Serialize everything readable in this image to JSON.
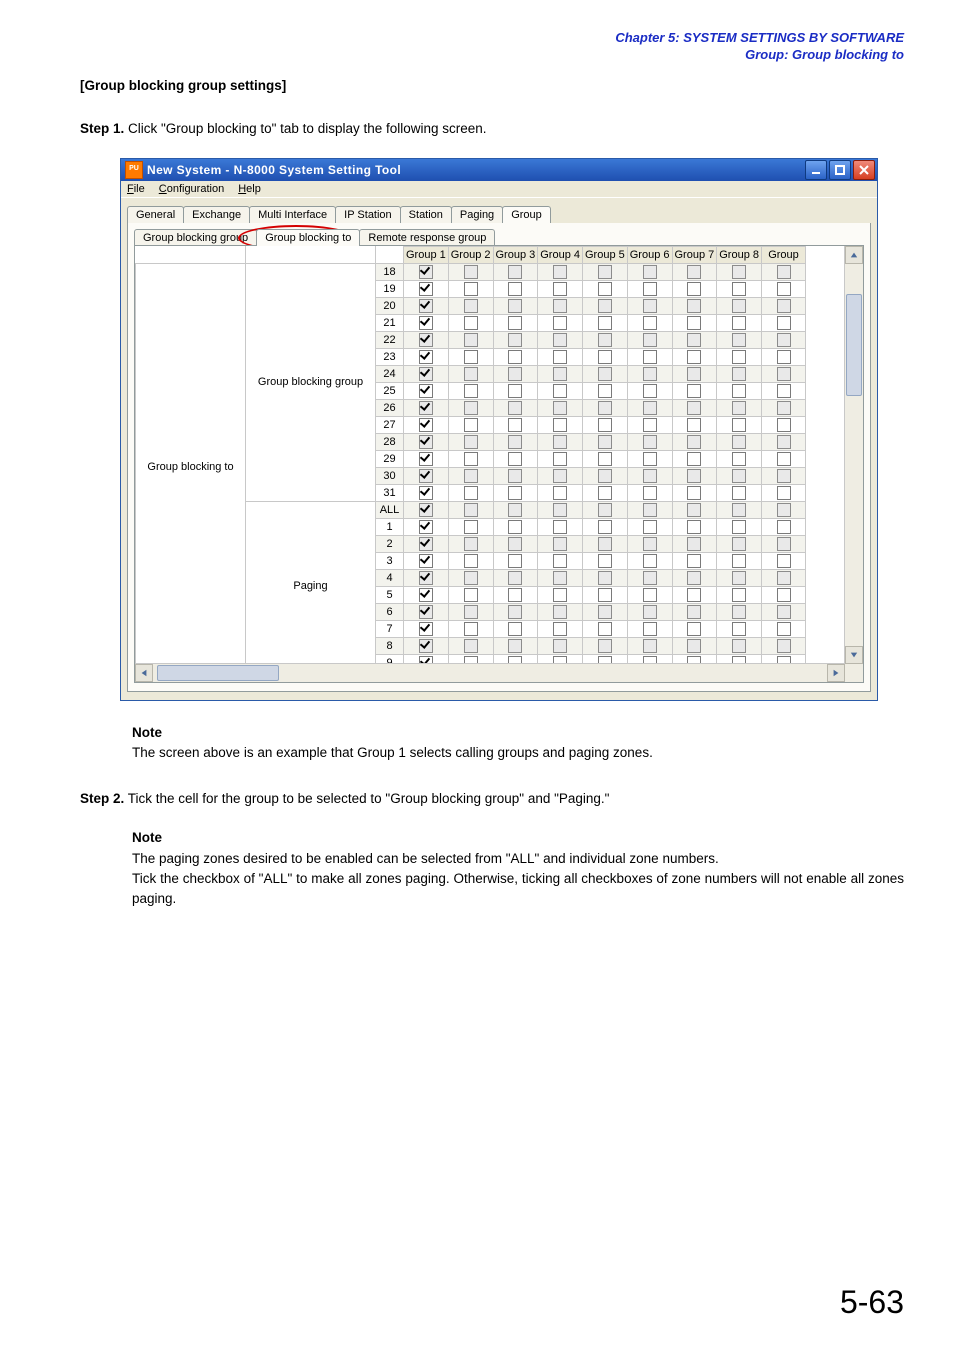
{
  "header": {
    "chapter": "Chapter 5:  SYSTEM SETTINGS BY SOFTWARE",
    "group": "Group: Group blocking to"
  },
  "section_title": "[Group blocking group settings]",
  "step1": {
    "label": "Step 1.",
    "text": " Click \"Group blocking to\" tab to display the following screen."
  },
  "window": {
    "title": "New System - N-8000 System Setting Tool",
    "appicon": "PU"
  },
  "menu": {
    "file": "File",
    "configuration": "Configuration",
    "help": "Help"
  },
  "tabs_top": [
    "General",
    "Exchange",
    "Multi Interface",
    "IP Station",
    "Station",
    "Paging",
    "Group"
  ],
  "tabs_top_active": 6,
  "subtabs": [
    "Group blocking group",
    "Group blocking to",
    "Remote response group"
  ],
  "subtabs_active": 1,
  "grid": {
    "rowhdr1": "Group blocking to",
    "rowhdr2a": "Group blocking group",
    "rowhdr2b": "Paging",
    "cols": [
      "Group 1",
      "Group 2",
      "Group 3",
      "Group 4",
      "Group 5",
      "Group 6",
      "Group 7",
      "Group 8",
      "Group"
    ],
    "rowsA": [
      "18",
      "19",
      "20",
      "21",
      "22",
      "23",
      "24",
      "25",
      "26",
      "27",
      "28",
      "29",
      "30",
      "31"
    ],
    "rowsB": [
      "ALL",
      "1",
      "2",
      "3",
      "4",
      "5",
      "6",
      "7",
      "8",
      "9"
    ]
  },
  "note1": {
    "head": "Note",
    "text": "The screen above is an example that Group 1 selects calling groups and paging zones."
  },
  "step2": {
    "label": "Step 2.",
    "text": " Tick the cell for the group to be selected to \"Group blocking group\" and \"Paging.\""
  },
  "note2": {
    "head": "Note",
    "line1": "The paging zones desired to be enabled can be selected from \"ALL\" and individual zone numbers.",
    "line2": "Tick the checkbox of \"ALL\" to make all zones paging. Otherwise, ticking all checkboxes of zone numbers will not enable all zones paging."
  },
  "page_number": "5-63"
}
